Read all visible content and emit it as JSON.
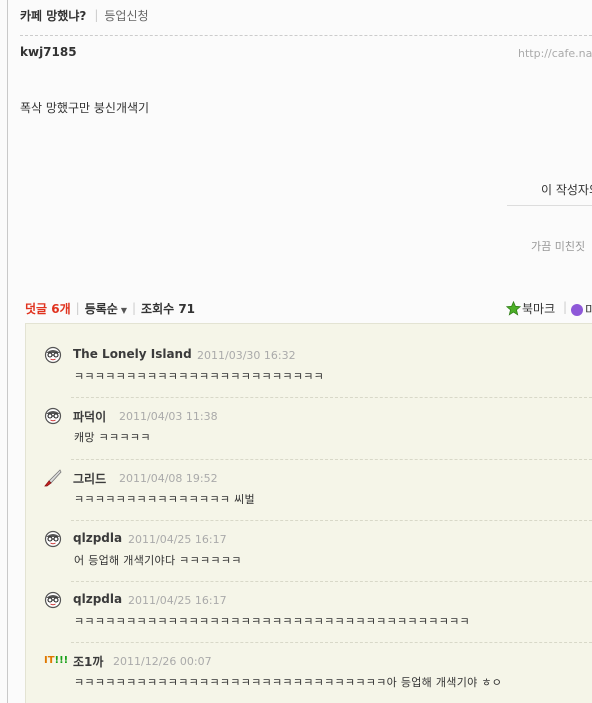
{
  "header": {
    "title": "카페 망했냐?",
    "promo_link": "등업신청"
  },
  "post": {
    "author": "kwj7185",
    "url": "http://cafe.na",
    "body": "폭삭 망했구만 붕신개색기",
    "author_other_label": "이 작성자의",
    "other_post": "가끔 미친짓"
  },
  "comment_bar": {
    "count_label": "덧글 6개",
    "sort_label": "등록순",
    "views_label": "조회수 71",
    "bookmark_label": "북마크",
    "extra_label": "미"
  },
  "comments": [
    {
      "nick": "The Lonely Island",
      "date": "2011/03/30 16:32",
      "text": "ㅋㅋㅋㅋㅋㅋㅋㅋㅋㅋㅋㅋㅋㅋㅋㅋㅋㅋㅋㅋㅋㅋㅋㅋ",
      "icon": "glasses-face-icon"
    },
    {
      "nick": "파덕이",
      "date": "2011/04/03 11:38",
      "text": "캐망 ㅋㅋㅋㅋㅋ",
      "icon": "glasses-face-icon"
    },
    {
      "nick": "그리드",
      "date": "2011/04/08 19:52",
      "text": "ㅋㅋㅋㅋㅋㅋㅋㅋㅋㅋㅋㅋㅋㅋㅋ 씨벌",
      "icon": "knife-icon"
    },
    {
      "nick": "qlzpdla",
      "date": "2011/04/25 16:17",
      "text": "어 등업해 개색기야다 ㅋㅋㅋㅋㅋㅋ",
      "icon": "glasses-face-icon"
    },
    {
      "nick": "qlzpdla",
      "date": "2011/04/25 16:17",
      "text": "ㅋㅋㅋㅋㅋㅋㅋㅋㅋㅋㅋㅋㅋㅋㅋㅋㅋㅋㅋㅋㅋㅋㅋㅋㅋㅋㅋㅋㅋㅋㅋㅋㅋㅋㅋㅋㅋㅋ",
      "icon": "glasses-face-icon"
    },
    {
      "nick": "조1까",
      "date": "2011/12/26 00:07",
      "text": "ㅋㅋㅋㅋㅋㅋㅋㅋㅋㅋㅋㅋㅋㅋㅋㅋㅋㅋㅋㅋㅋㅋㅋㅋㅋㅋㅋㅋㅋㅋ아 등업해 개색기야 ㅎㅇ",
      "icon": "it-badge-icon",
      "badge_text": "IT",
      "badge_marks": "!!!"
    }
  ]
}
